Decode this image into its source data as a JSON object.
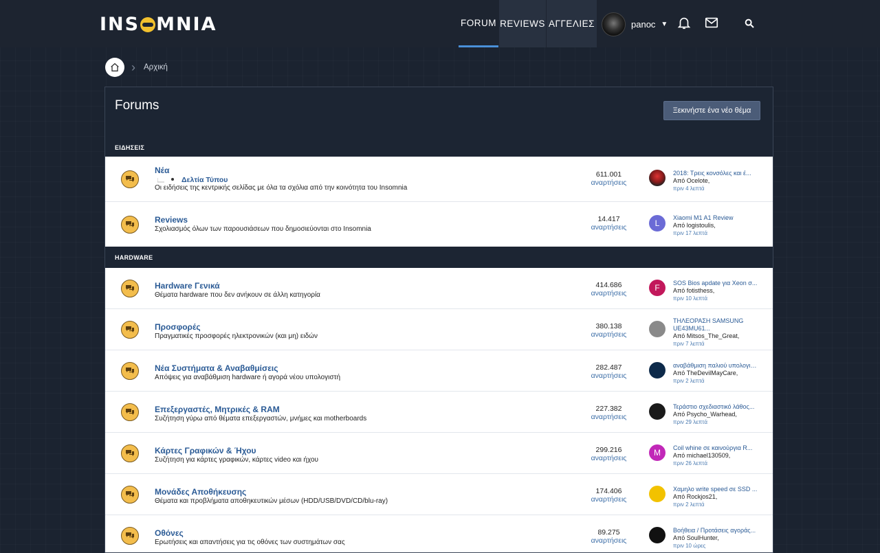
{
  "header": {
    "logo": "INSOMNIA",
    "nav": [
      "FORUM",
      "REVIEWS",
      "ΑΓΓΕΛΙΕΣ"
    ],
    "username": "panoc"
  },
  "breadcrumb": {
    "home": "Αρχική"
  },
  "page": {
    "title": "Forums",
    "new_thread": "Ξεκινήστε ένα νέο θέμα"
  },
  "categories": [
    {
      "name": "ΕΙΔΗΣΕΙΣ",
      "forums": [
        {
          "title": "Νέα",
          "sub": "Δελτία Τύπου",
          "desc": "Οι ειδήσεις της κεντρικής σελίδας με όλα τα σχόλια από την κοινότητα του Insomnia",
          "count": "611.001",
          "count_label": "αναρτήσεις",
          "last_title": "2018: Τρεις κονσόλες και έ...",
          "last_by": "Από Ocelote,",
          "last_time": "πριν 4 λεπτά",
          "avatar_letter": "",
          "avatar_color": "#8b1c1c"
        },
        {
          "title": "Reviews",
          "desc": "Σχολιασμός όλων των παρουσιάσεων που δημοσιεύονται στο Insomnia",
          "count": "14.417",
          "count_label": "αναρτήσεις",
          "last_title": "Xiaomi M1 A1 Review",
          "last_by": "Από logistoulis,",
          "last_time": "πριν 17 λεπτά",
          "avatar_letter": "L",
          "avatar_color": "#6b6bd6"
        }
      ]
    },
    {
      "name": "HARDWARE",
      "forums": [
        {
          "title": "Hardware Γενικά",
          "desc": "Θέματα hardware που δεν ανήκουν σε άλλη κατηγορία",
          "count": "414.686",
          "count_label": "αναρτήσεις",
          "last_title": "SOS Bios apdate για Xeon σ...",
          "last_by": "Από fotisthess,",
          "last_time": "πριν 10 λεπτά",
          "avatar_letter": "F",
          "avatar_color": "#c2185b"
        },
        {
          "title": "Προσφορές",
          "desc": "Πραγματικές προσφορές ηλεκτρονικών (και μη) ειδών",
          "count": "380.138",
          "count_label": "αναρτήσεις",
          "last_title": "ΤΗΛΕΟΡΑΣΗ SAMSUNG UE43MU61...",
          "last_by": "Από Mitsos_The_Great,",
          "last_time": "πριν 7 λεπτά",
          "avatar_letter": "",
          "avatar_color": "#8a8a8a"
        },
        {
          "title": "Νέα Συστήματα & Αναβαθμίσεις",
          "desc": "Απόψεις για αναβάθμιση hardware ή αγορά νέου υπολογιστή",
          "count": "282.487",
          "count_label": "αναρτήσεις",
          "last_title": "αναβάθμιση παλιού υπολογισ...",
          "last_by": "Από TheDevilMayCare,",
          "last_time": "πριν 2 λεπτά",
          "avatar_letter": "",
          "avatar_color": "#0d2a4a"
        },
        {
          "title": "Επεξεργαστές, Μητρικές & RAM",
          "desc": "Συζήτηση γύρω από θέματα επεξεργαστών, μνήμες και motherboards",
          "count": "227.382",
          "count_label": "αναρτήσεις",
          "last_title": "Τεράστιο σχεδιαστικό λάθος...",
          "last_by": "Από Psycho_Warhead,",
          "last_time": "πριν 29 λεπτά",
          "avatar_letter": "",
          "avatar_color": "#1a1a1a"
        },
        {
          "title": "Κάρτες Γραφικών & Ήχου",
          "desc": "Συζήτηση για κάρτες γραφικών, κάρτες video και ήχου",
          "count": "299.216",
          "count_label": "αναρτήσεις",
          "last_title": "Coil whine σε καινούργια R...",
          "last_by": "Από michael130509,",
          "last_time": "πριν 26 λεπτά",
          "avatar_letter": "M",
          "avatar_color": "#c128b8"
        },
        {
          "title": "Μονάδες Αποθήκευσης",
          "desc": "Θέματα και προβλήματα αποθηκευτικών μέσων (HDD/USB/DVD/CD/blu-ray)",
          "count": "174.406",
          "count_label": "αναρτήσεις",
          "last_title": "Χαμηλο write speed σε SSD ...",
          "last_by": "Από Rockjos21,",
          "last_time": "πριν 2 λεπτά",
          "avatar_letter": "",
          "avatar_color": "#f2c200"
        },
        {
          "title": "Οθόνες",
          "desc": "Ερωτήσεις και απαντήσεις για τις οθόνες των συστημάτων σας",
          "count": "89.275",
          "count_label": "αναρτήσεις",
          "last_title": "Βοήθεια / Προτάσεις αγοράς...",
          "last_by": "Από SoulHunter,",
          "last_time": "πριν 10 ώρες",
          "avatar_letter": "",
          "avatar_color": "#111111"
        }
      ]
    }
  ]
}
